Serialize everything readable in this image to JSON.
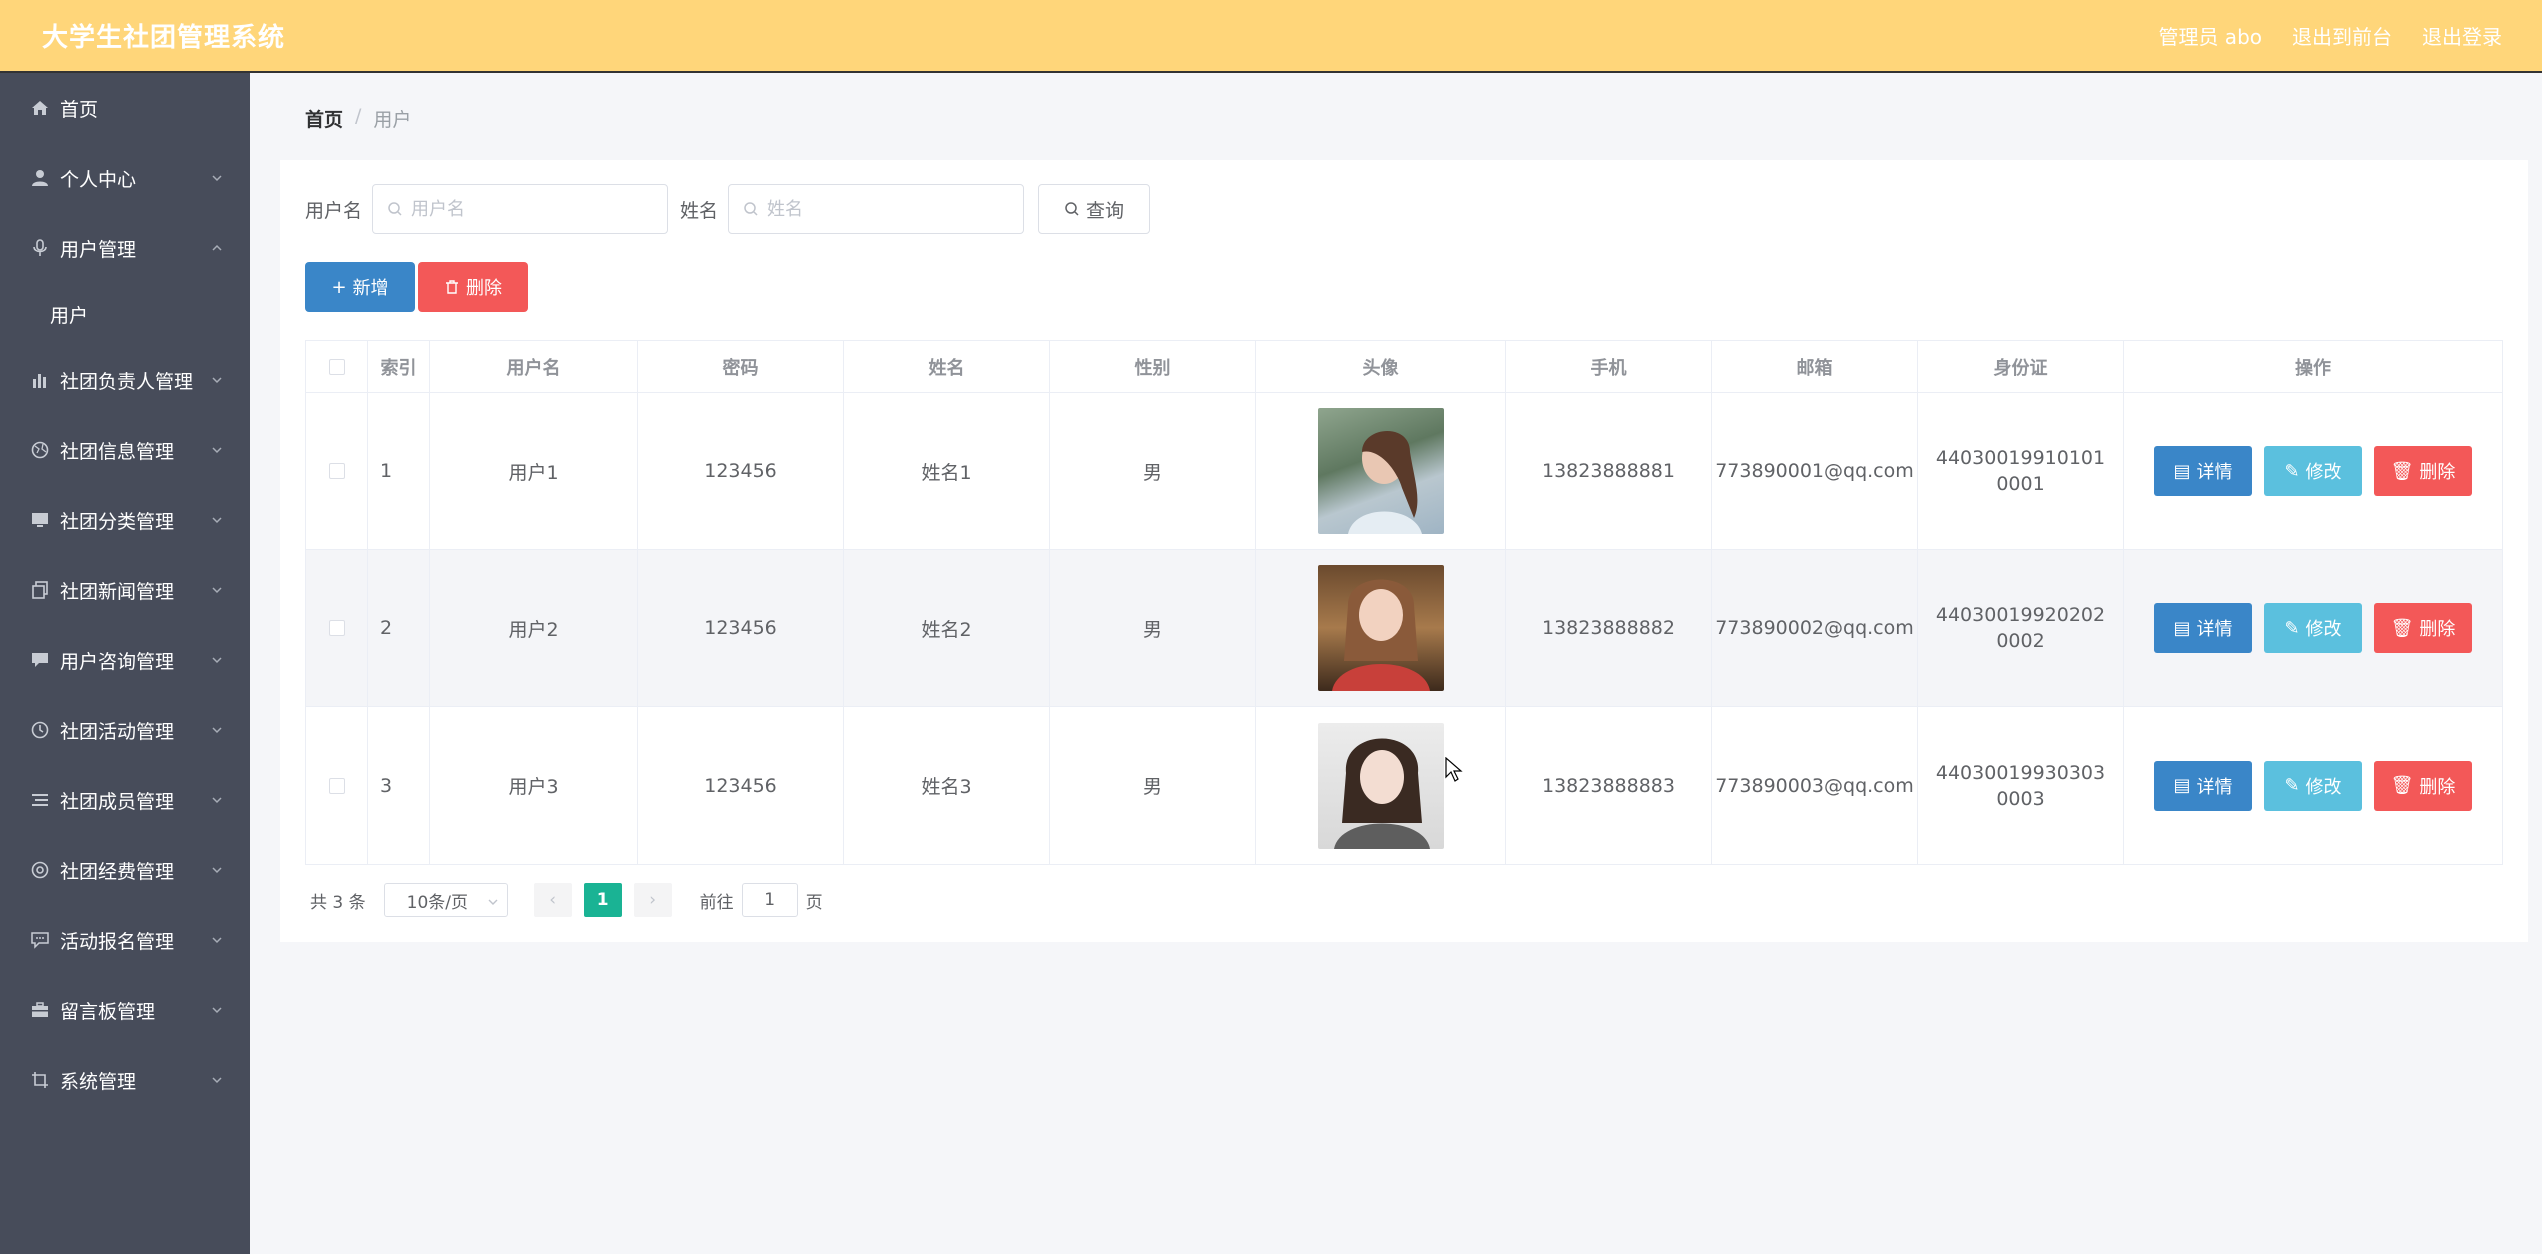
{
  "header": {
    "title": "大学生社团管理系统",
    "actions": [
      "管理员 abo",
      "退出到前台",
      "退出登录"
    ]
  },
  "sidebar": {
    "items": [
      {
        "label": "首页",
        "icon": "home-icon",
        "chevron": false
      },
      {
        "label": "个人中心",
        "icon": "user-icon",
        "chevron": true
      },
      {
        "label": "用户管理",
        "icon": "mic-icon",
        "chevron": true,
        "expanded": true
      },
      {
        "label": "社团负责人管理",
        "icon": "bar-chart-icon",
        "chevron": true
      },
      {
        "label": "社团信息管理",
        "icon": "globe-icon",
        "chevron": true
      },
      {
        "label": "社团分类管理",
        "icon": "monitor-icon",
        "chevron": true
      },
      {
        "label": "社团新闻管理",
        "icon": "copy-icon",
        "chevron": true
      },
      {
        "label": "用户咨询管理",
        "icon": "chat-icon",
        "chevron": true
      },
      {
        "label": "社团活动管理",
        "icon": "clock-icon",
        "chevron": true
      },
      {
        "label": "社团成员管理",
        "icon": "list-icon",
        "chevron": true
      },
      {
        "label": "社团经费管理",
        "icon": "compass-icon",
        "chevron": true
      },
      {
        "label": "活动报名管理",
        "icon": "message-icon",
        "chevron": true
      },
      {
        "label": "留言板管理",
        "icon": "briefcase-icon",
        "chevron": true
      },
      {
        "label": "系统管理",
        "icon": "crop-icon",
        "chevron": true
      }
    ],
    "submenu": [
      "用户"
    ]
  },
  "breadcrumb": {
    "home": "首页",
    "separator": "/",
    "current": "用户"
  },
  "search": {
    "username_label": "用户名",
    "username_placeholder": "用户名",
    "name_label": "姓名",
    "name_placeholder": "姓名",
    "query_label": "查询"
  },
  "toolbar": {
    "add_label": "新增",
    "delete_label": "删除"
  },
  "table": {
    "columns": [
      "",
      "索引",
      "用户名",
      "密码",
      "姓名",
      "性别",
      "头像",
      "手机",
      "邮箱",
      "身份证",
      "操作"
    ],
    "rows": [
      {
        "index": "1",
        "username": "用户1",
        "password": "123456",
        "name": "姓名1",
        "gender": "男",
        "phone": "13823888881",
        "email": "773890001@qq.com",
        "idcard": "440300199101010001"
      },
      {
        "index": "2",
        "username": "用户2",
        "password": "123456",
        "name": "姓名2",
        "gender": "男",
        "phone": "13823888882",
        "email": "773890002@qq.com",
        "idcard": "440300199202020002"
      },
      {
        "index": "3",
        "username": "用户3",
        "password": "123456",
        "name": "姓名3",
        "gender": "男",
        "phone": "13823888883",
        "email": "773890003@qq.com",
        "idcard": "440300199303030003"
      }
    ],
    "ops": {
      "detail": "详情",
      "edit": "修改",
      "delete": "删除"
    }
  },
  "pagination": {
    "total": "共 3 条",
    "page_size": "10条/页",
    "current_page": "1",
    "goto_prefix": "前往",
    "goto_value": "1",
    "goto_suffix": "页"
  },
  "colors": {
    "header_bg": "#ffd67a",
    "sidebar_bg": "#474c5a",
    "primary": "#3a86c8",
    "info": "#5bc0de",
    "danger": "#f35858",
    "active_page": "#1ab394"
  }
}
